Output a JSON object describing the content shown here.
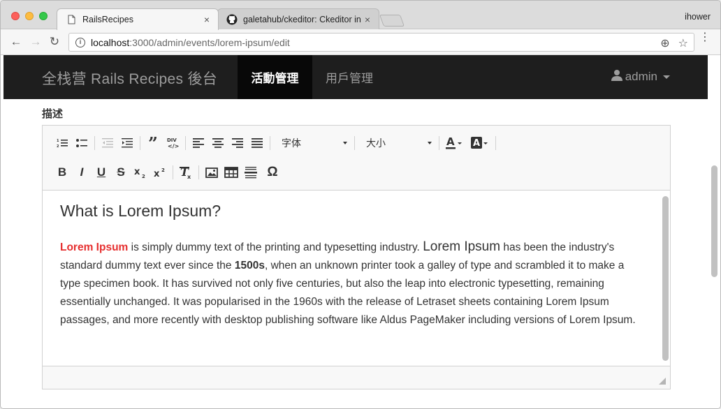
{
  "browser": {
    "tabs": [
      {
        "title": "RailsRecipes",
        "close": "×"
      },
      {
        "title": "galetahub/ckeditor: Ckeditor in",
        "close": "×"
      }
    ],
    "profile": "ihower",
    "url_host": "localhost",
    "url_path": ":3000/admin/events/lorem-ipsum/edit",
    "icons": {
      "back": "←",
      "forward": "→",
      "reload": "↻",
      "zoom": "⊕",
      "star": "☆",
      "menu": "⋮",
      "info": "i"
    }
  },
  "navbar": {
    "brand": "全栈营 Rails Recipes 後台",
    "items": [
      {
        "label": "活動管理",
        "active": true
      },
      {
        "label": "用戶管理",
        "active": false
      }
    ],
    "user": "admin"
  },
  "form": {
    "label": "描述"
  },
  "editor": {
    "font_combo": "字体",
    "size_combo": "大小",
    "toolbar_row1": [
      "numbered-list",
      "bulleted-list",
      "decrease-indent",
      "increase-indent",
      "blockquote",
      "div",
      "align-left",
      "align-center",
      "align-right",
      "justify"
    ],
    "toolbar_row2": [
      "bold",
      "italic",
      "underline",
      "strike",
      "subscript",
      "superscript",
      "remove-format",
      "image",
      "table",
      "horizontal-line",
      "special-char"
    ],
    "heading": "What is Lorem Ipsum?",
    "para": {
      "red": "Lorem Ipsum",
      "t1": " is simply dummy text of the printing and typesetting industry. ",
      "big": "Lorem Ipsum",
      "t2": " has been the industry's standard dummy text ever since the ",
      "bold": "1500s",
      "t3": ", when an unknown printer took a galley of type and scrambled it to make a type specimen book. It has survived not only five centuries, but also the leap into electronic typesetting, remaining essentially unchanged. It was popularised in the 1960s with the release of Letraset sheets containing Lorem Ipsum passages, and more recently with desktop publishing software like Aldus PageMaker including versions of Lorem Ipsum."
    }
  }
}
